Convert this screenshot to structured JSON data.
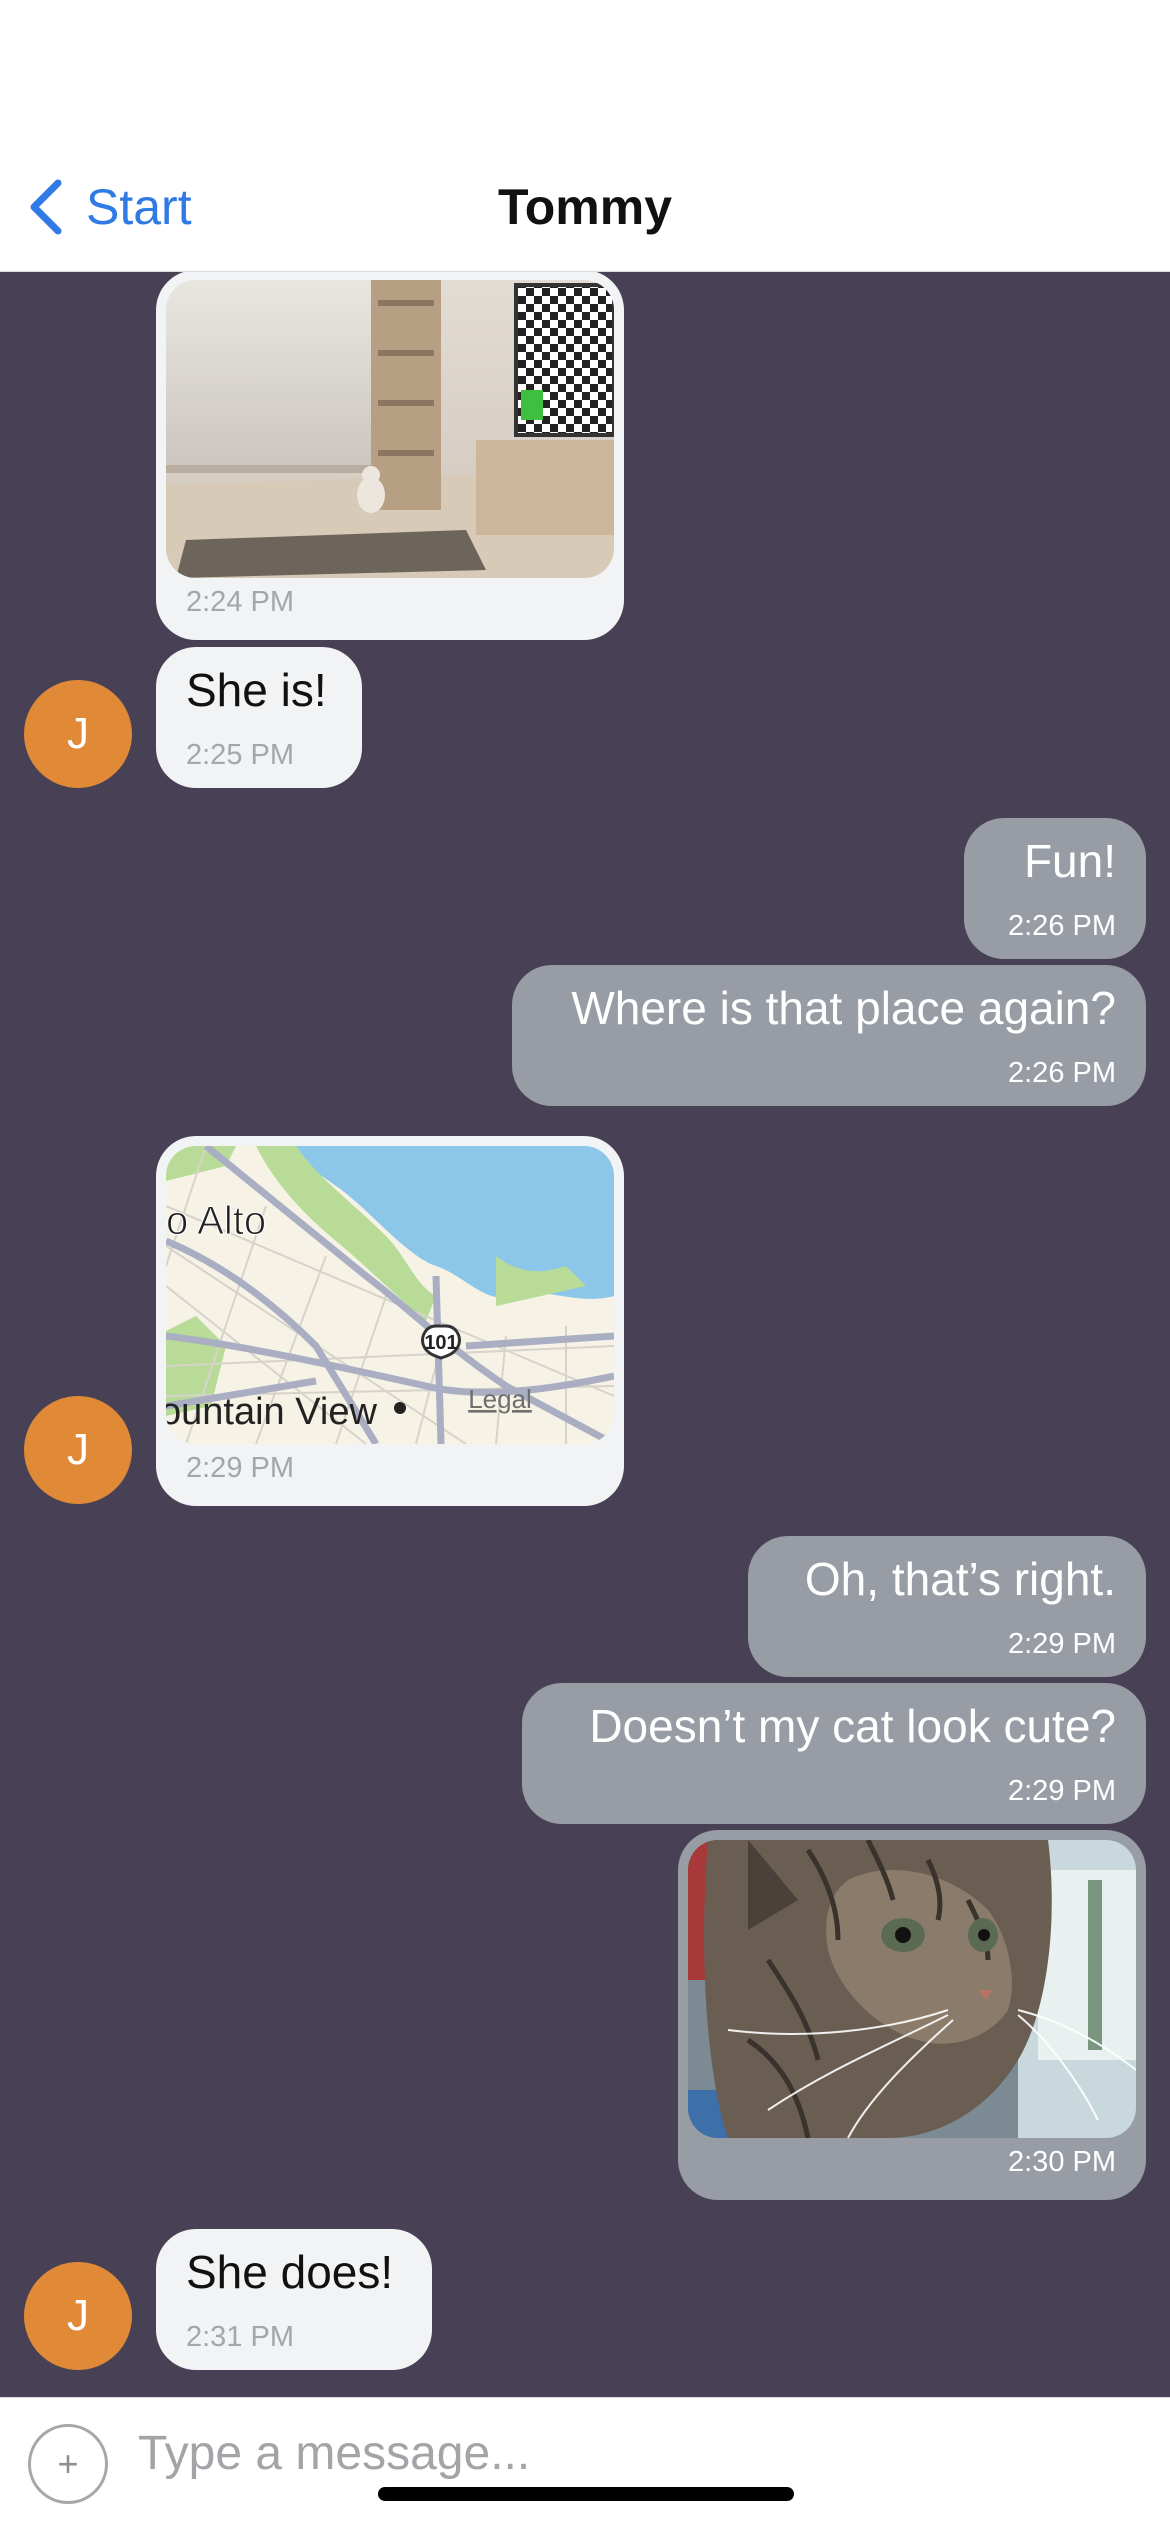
{
  "header": {
    "back_label": "Start",
    "title": "Tommy"
  },
  "avatar_initial": "J",
  "messages": [
    {
      "side": "in",
      "type": "image",
      "image": "cat in living room with TV",
      "time": "2:24 PM"
    },
    {
      "side": "in",
      "type": "text",
      "text": "She is!",
      "time": "2:25 PM"
    },
    {
      "side": "out",
      "type": "text",
      "text": "Fun!",
      "time": "2:26 PM"
    },
    {
      "side": "out",
      "type": "text",
      "text": "Where is that place again?",
      "time": "2:26 PM"
    },
    {
      "side": "in",
      "type": "location",
      "map_labels": [
        "o Alto",
        "ountain View",
        "101",
        "Legal"
      ],
      "time": "2:29 PM"
    },
    {
      "side": "out",
      "type": "text",
      "text": "Oh, that’s right.",
      "time": "2:29 PM"
    },
    {
      "side": "out",
      "type": "text",
      "text": "Doesn’t my cat look cute?",
      "time": "2:29 PM"
    },
    {
      "side": "out",
      "type": "image",
      "image": "tabby cat close-up",
      "time": "2:30 PM"
    },
    {
      "side": "in",
      "type": "text",
      "text": "She does!",
      "time": "2:31 PM"
    }
  ],
  "composer": {
    "add_icon": "plus-icon",
    "add_label": "+",
    "placeholder": "Type a message..."
  },
  "colors": {
    "accent": "#2f7ae5",
    "chat_bg": "#484155",
    "incoming": "#f2f3f5",
    "outgoing": "#989ca4",
    "avatar": "#e08937"
  }
}
